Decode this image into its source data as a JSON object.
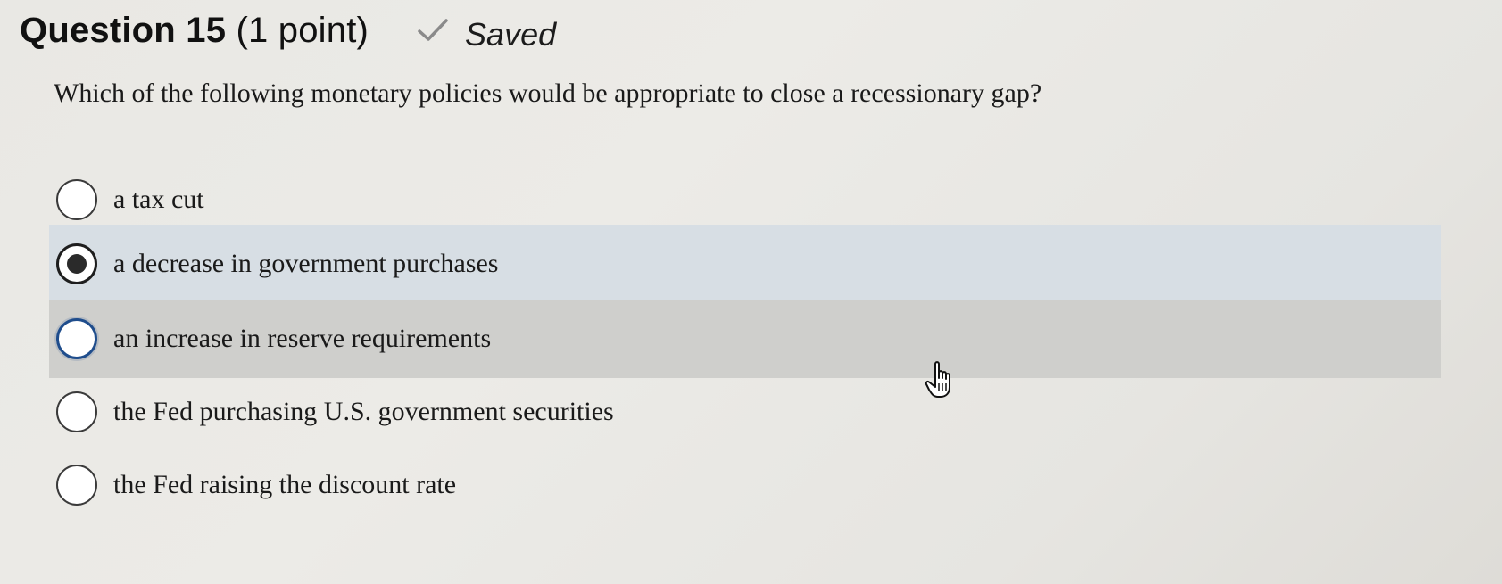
{
  "question": {
    "number_label": "Question 15",
    "points_label": "(1 point)",
    "status_icon": "check-icon",
    "status_text": "Saved",
    "prompt": "Which of the following monetary policies would be appropriate to close a recessionary gap?"
  },
  "options": [
    {
      "label": "a tax cut",
      "selected": false
    },
    {
      "label": "a decrease in government purchases",
      "selected": true
    },
    {
      "label": "an increase in reserve requirements",
      "selected": false
    },
    {
      "label": "the Fed purchasing U.S. government securities",
      "selected": false
    },
    {
      "label": "the Fed raising the discount rate",
      "selected": false
    }
  ],
  "colors": {
    "selected_row": "#d7dee4",
    "hover_row": "#cfcfcc",
    "focus_ring": "#1f4d8c"
  }
}
